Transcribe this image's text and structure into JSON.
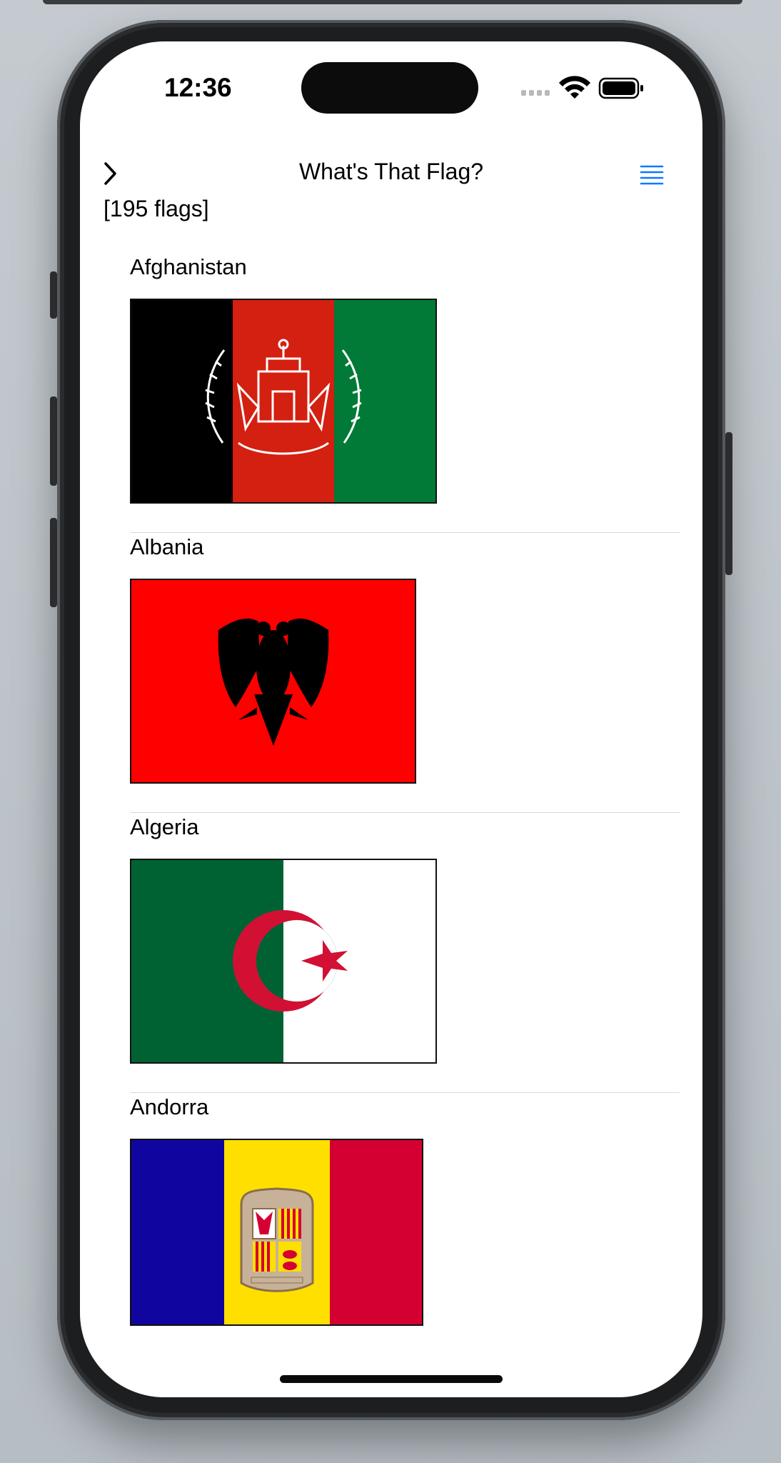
{
  "status_bar": {
    "time": "12:36"
  },
  "nav": {
    "title": "What's That Flag?"
  },
  "list": {
    "count_label": "[195 flags]",
    "items": [
      {
        "name": "Afghanistan",
        "flag": "afghanistan-flag"
      },
      {
        "name": "Albania",
        "flag": "albania-flag"
      },
      {
        "name": "Algeria",
        "flag": "algeria-flag"
      },
      {
        "name": "Andorra",
        "flag": "andorra-flag"
      }
    ]
  },
  "colors": {
    "accent": "#0a7aff",
    "afghanistan": [
      "#000000",
      "#d32011",
      "#007a36"
    ],
    "albania": [
      "#ff0000",
      "#000000"
    ],
    "algeria": [
      "#006233",
      "#ffffff",
      "#d21034"
    ],
    "andorra": [
      "#10069f",
      "#fedf00",
      "#d50032"
    ]
  }
}
